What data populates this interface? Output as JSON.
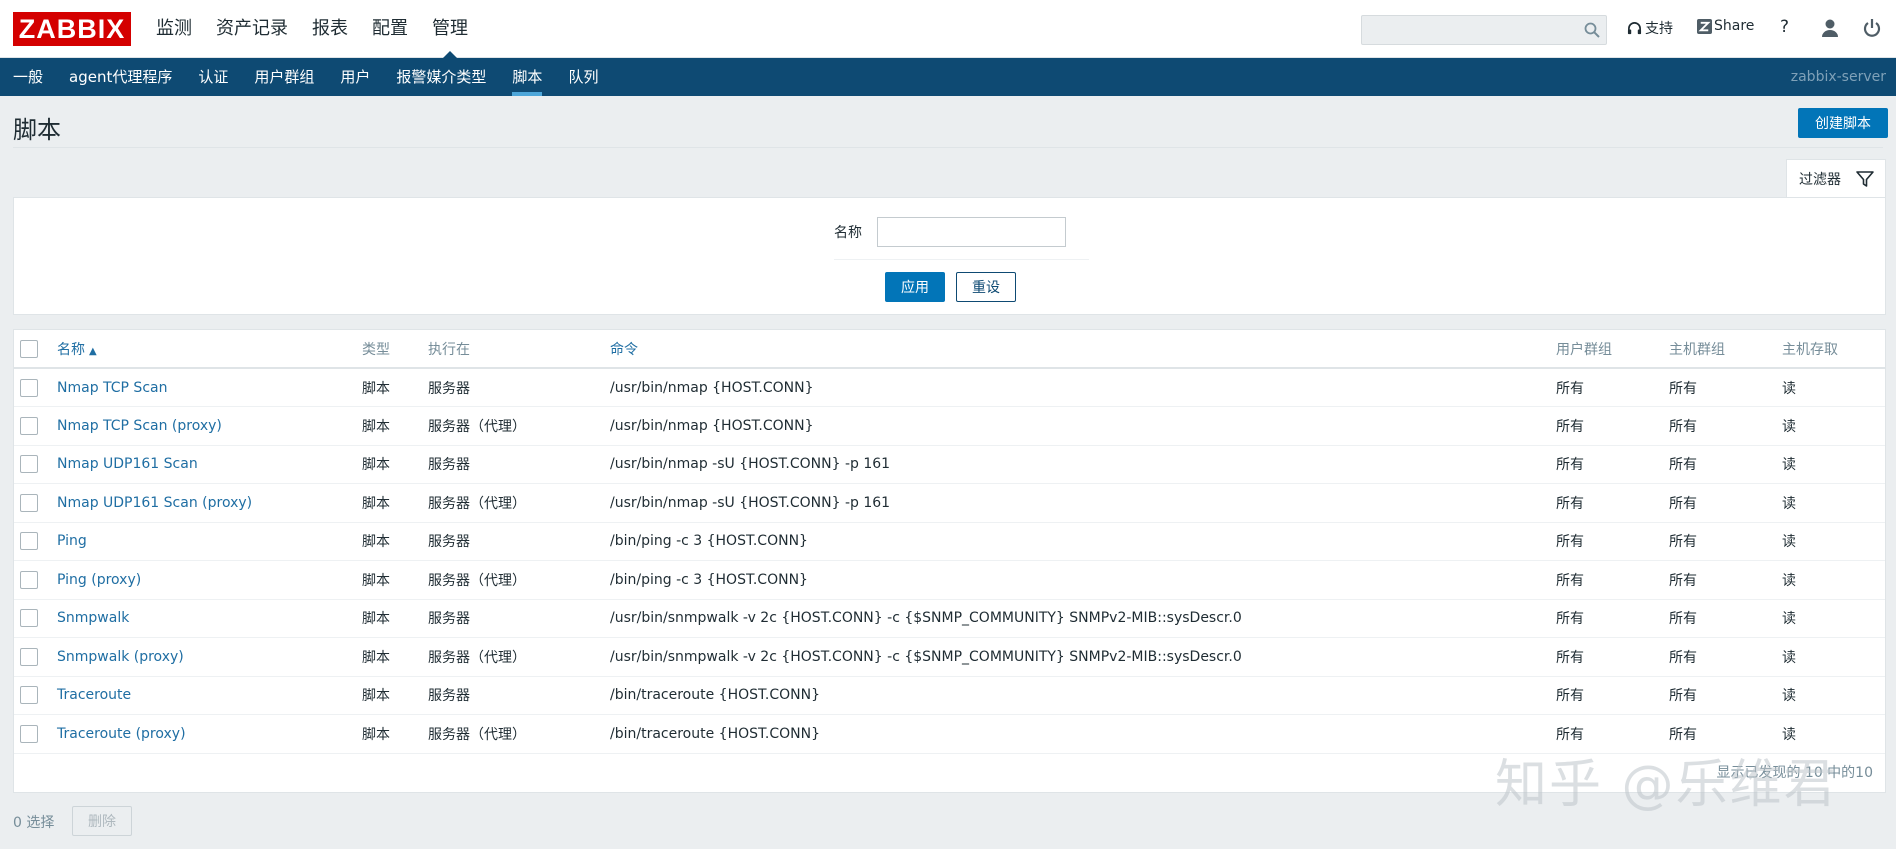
{
  "logo": "ZABBIX",
  "main_nav": [
    "监测",
    "资产记录",
    "报表",
    "配置",
    "管理"
  ],
  "header": {
    "search_placeholder": "",
    "support_label": "支持",
    "share_label": "Share",
    "help_label": "?"
  },
  "sub_nav": [
    "一般",
    "agent代理程序",
    "认证",
    "用户群组",
    "用户",
    "报警媒介类型",
    "脚本",
    "队列"
  ],
  "server_name": "zabbix-server",
  "page_title": "脚本",
  "create_button": "创建脚本",
  "filter": {
    "tab_label": "过滤器",
    "name_label": "名称",
    "name_value": "",
    "apply_label": "应用",
    "reset_label": "重设"
  },
  "table": {
    "headers": [
      "名称",
      "类型",
      "执行在",
      "命令",
      "用户群组",
      "主机群组",
      "主机存取"
    ],
    "rows": [
      [
        "Nmap TCP Scan",
        "脚本",
        "服务器",
        "/usr/bin/nmap {HOST.CONN}",
        "所有",
        "所有",
        "读"
      ],
      [
        "Nmap TCP Scan (proxy)",
        "脚本",
        "服务器（代理）",
        "/usr/bin/nmap {HOST.CONN}",
        "所有",
        "所有",
        "读"
      ],
      [
        "Nmap UDP161 Scan",
        "脚本",
        "服务器",
        "/usr/bin/nmap -sU {HOST.CONN} -p 161",
        "所有",
        "所有",
        "读"
      ],
      [
        "Nmap UDP161 Scan (proxy)",
        "脚本",
        "服务器（代理）",
        "/usr/bin/nmap -sU {HOST.CONN} -p 161",
        "所有",
        "所有",
        "读"
      ],
      [
        "Ping",
        "脚本",
        "服务器",
        "/bin/ping -c 3 {HOST.CONN}",
        "所有",
        "所有",
        "读"
      ],
      [
        "Ping (proxy)",
        "脚本",
        "服务器（代理）",
        "/bin/ping -c 3 {HOST.CONN}",
        "所有",
        "所有",
        "读"
      ],
      [
        "Snmpwalk",
        "脚本",
        "服务器",
        "/usr/bin/snmpwalk -v 2c {HOST.CONN} -c {$SNMP_COMMUNITY} SNMPv2-MIB::sysDescr.0",
        "所有",
        "所有",
        "读"
      ],
      [
        "Snmpwalk (proxy)",
        "脚本",
        "服务器（代理）",
        "/usr/bin/snmpwalk -v 2c {HOST.CONN} -c {$SNMP_COMMUNITY} SNMPv2-MIB::sysDescr.0",
        "所有",
        "所有",
        "读"
      ],
      [
        "Traceroute",
        "脚本",
        "服务器",
        "/bin/traceroute {HOST.CONN}",
        "所有",
        "所有",
        "读"
      ],
      [
        "Traceroute (proxy)",
        "脚本",
        "服务器（代理）",
        "/bin/traceroute {HOST.CONN}",
        "所有",
        "所有",
        "读"
      ]
    ],
    "paging_text": "显示已发现的 10 中的10"
  },
  "footer": {
    "selected_count": "0 选择",
    "delete_label": "删除"
  },
  "watermark": "知乎 @乐维君"
}
